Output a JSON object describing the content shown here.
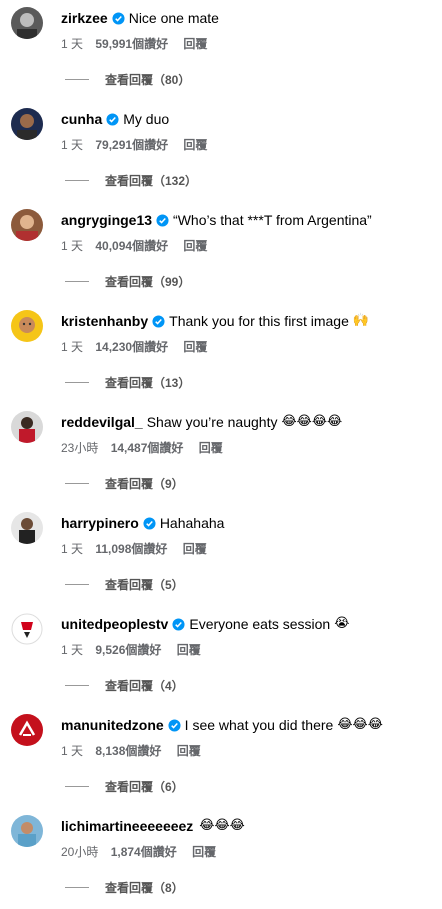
{
  "comments": [
    {
      "user": "zirkzee",
      "verified": true,
      "text": "Nice one mate",
      "emoji": "",
      "time": "1 天",
      "likes": "59,991個讚好",
      "reply": "回覆",
      "view": "查看回覆（80）"
    },
    {
      "user": "cunha",
      "verified": true,
      "text": "My duo",
      "emoji": "",
      "time": "1 天",
      "likes": "79,291個讚好",
      "reply": "回覆",
      "view": "查看回覆（132）"
    },
    {
      "user": "angryginge13",
      "verified": true,
      "text": "“Who’s that ***T from Argentina”",
      "emoji": "",
      "time": "1 天",
      "likes": "40,094個讚好",
      "reply": "回覆",
      "view": "查看回覆（99）"
    },
    {
      "user": "kristenhanby",
      "verified": true,
      "text": "Thank you for this first image",
      "emoji": "🙌",
      "time": "1 天",
      "likes": "14,230個讚好",
      "reply": "回覆",
      "view": "查看回覆（13）"
    },
    {
      "user": "reddevilgal_",
      "verified": false,
      "text": "Shaw you’re naughty",
      "emoji": "😂😂😂😂",
      "time": "23小時",
      "likes": "14,487個讚好",
      "reply": "回覆",
      "view": "查看回覆（9）"
    },
    {
      "user": "harrypinero",
      "verified": true,
      "text": "Hahahaha",
      "emoji": "",
      "time": "1 天",
      "likes": "11,098個讚好",
      "reply": "回覆",
      "view": "查看回覆（5）"
    },
    {
      "user": "unitedpeoplestv",
      "verified": true,
      "text": "Everyone eats session",
      "emoji": "😭",
      "time": "1 天",
      "likes": "9,526個讚好",
      "reply": "回覆",
      "view": "查看回覆（4）"
    },
    {
      "user": "manunitedzone",
      "verified": true,
      "text": "I see what you did there",
      "emoji": "😂😂😂",
      "time": "1 天",
      "likes": "8,138個讚好",
      "reply": "回覆",
      "view": "查看回覆（6）"
    },
    {
      "user": "lichimartineeeeeeez",
      "verified": false,
      "text": "",
      "emoji": "😂😂😂",
      "time": "20小時",
      "likes": "1,874個讚好",
      "reply": "回覆",
      "view": "查看回覆（8）"
    }
  ],
  "colors": {
    "verified": "#0095f6",
    "meta": "#65676b"
  }
}
